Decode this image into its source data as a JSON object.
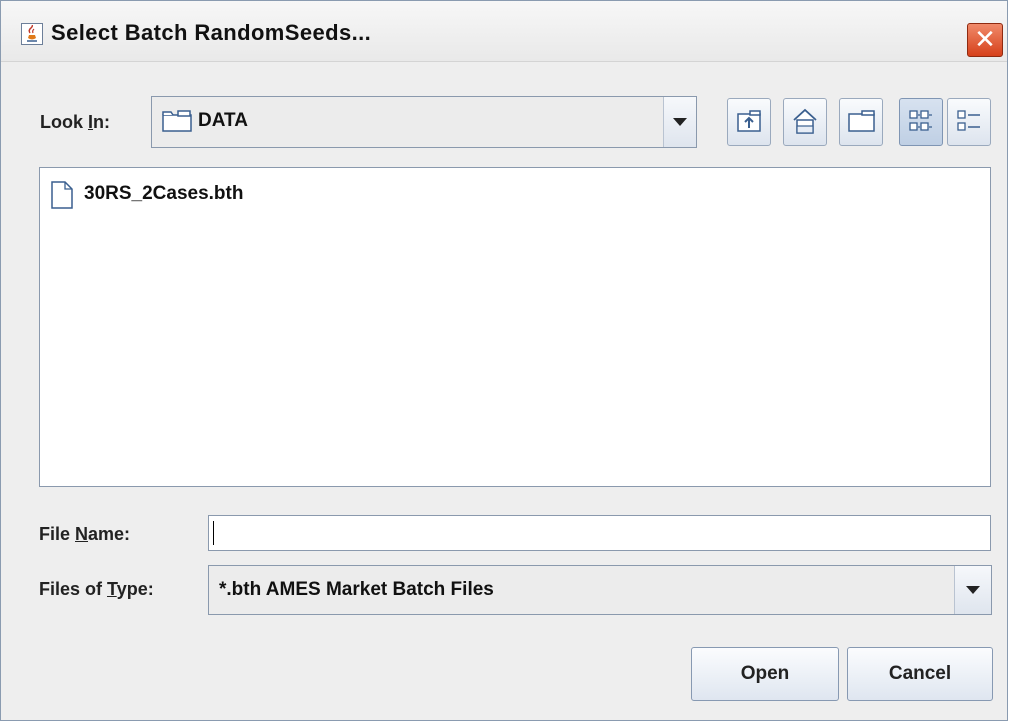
{
  "window": {
    "title": "Select Batch RandomSeeds...",
    "title_icon": "java-cup-icon",
    "close_glyph": "✕"
  },
  "lookin": {
    "label_pre": "Look ",
    "label_mnemonic": "I",
    "label_post": "n:",
    "value": "DATA",
    "icon": "folder-icon"
  },
  "toolbar": {
    "buttons": [
      {
        "name": "up-one-level",
        "icon": "folder-up-icon"
      },
      {
        "name": "home",
        "icon": "home-icon"
      },
      {
        "name": "create-new-folder",
        "icon": "new-folder-icon"
      },
      {
        "name": "list-view",
        "icon": "list-view-icon",
        "selected": true
      },
      {
        "name": "details-view",
        "icon": "details-view-icon",
        "selected": false
      }
    ]
  },
  "files": [
    {
      "name": "30RS_2Cases.bth",
      "icon": "file-icon"
    }
  ],
  "filename": {
    "label_pre": "File ",
    "label_mnemonic": "N",
    "label_post": "ame:",
    "value": "",
    "placeholder": ""
  },
  "filetype": {
    "label_pre": "Files of ",
    "label_mnemonic": "T",
    "label_post": "ype:",
    "value": "*.bth AMES Market Batch Files"
  },
  "buttons": {
    "open": "Open",
    "cancel": "Cancel"
  },
  "colors": {
    "window_bg": "#eeeeee",
    "close_red": "#d6401a",
    "border": "#8a99ad"
  }
}
